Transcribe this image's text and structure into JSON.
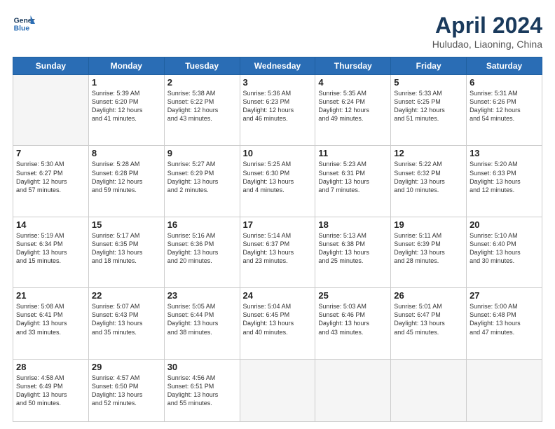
{
  "header": {
    "logo_line1": "General",
    "logo_line2": "Blue",
    "month": "April 2024",
    "location": "Huludao, Liaoning, China"
  },
  "days_of_week": [
    "Sunday",
    "Monday",
    "Tuesday",
    "Wednesday",
    "Thursday",
    "Friday",
    "Saturday"
  ],
  "weeks": [
    [
      {
        "day": null
      },
      {
        "day": "1",
        "sunrise": "5:39 AM",
        "sunset": "6:20 PM",
        "daylight": "12 hours and 41 minutes."
      },
      {
        "day": "2",
        "sunrise": "5:38 AM",
        "sunset": "6:22 PM",
        "daylight": "12 hours and 43 minutes."
      },
      {
        "day": "3",
        "sunrise": "5:36 AM",
        "sunset": "6:23 PM",
        "daylight": "12 hours and 46 minutes."
      },
      {
        "day": "4",
        "sunrise": "5:35 AM",
        "sunset": "6:24 PM",
        "daylight": "12 hours and 49 minutes."
      },
      {
        "day": "5",
        "sunrise": "5:33 AM",
        "sunset": "6:25 PM",
        "daylight": "12 hours and 51 minutes."
      },
      {
        "day": "6",
        "sunrise": "5:31 AM",
        "sunset": "6:26 PM",
        "daylight": "12 hours and 54 minutes."
      }
    ],
    [
      {
        "day": "7",
        "sunrise": "5:30 AM",
        "sunset": "6:27 PM",
        "daylight": "12 hours and 57 minutes."
      },
      {
        "day": "8",
        "sunrise": "5:28 AM",
        "sunset": "6:28 PM",
        "daylight": "12 hours and 59 minutes."
      },
      {
        "day": "9",
        "sunrise": "5:27 AM",
        "sunset": "6:29 PM",
        "daylight": "13 hours and 2 minutes."
      },
      {
        "day": "10",
        "sunrise": "5:25 AM",
        "sunset": "6:30 PM",
        "daylight": "13 hours and 4 minutes."
      },
      {
        "day": "11",
        "sunrise": "5:23 AM",
        "sunset": "6:31 PM",
        "daylight": "13 hours and 7 minutes."
      },
      {
        "day": "12",
        "sunrise": "5:22 AM",
        "sunset": "6:32 PM",
        "daylight": "13 hours and 10 minutes."
      },
      {
        "day": "13",
        "sunrise": "5:20 AM",
        "sunset": "6:33 PM",
        "daylight": "13 hours and 12 minutes."
      }
    ],
    [
      {
        "day": "14",
        "sunrise": "5:19 AM",
        "sunset": "6:34 PM",
        "daylight": "13 hours and 15 minutes."
      },
      {
        "day": "15",
        "sunrise": "5:17 AM",
        "sunset": "6:35 PM",
        "daylight": "13 hours and 18 minutes."
      },
      {
        "day": "16",
        "sunrise": "5:16 AM",
        "sunset": "6:36 PM",
        "daylight": "13 hours and 20 minutes."
      },
      {
        "day": "17",
        "sunrise": "5:14 AM",
        "sunset": "6:37 PM",
        "daylight": "13 hours and 23 minutes."
      },
      {
        "day": "18",
        "sunrise": "5:13 AM",
        "sunset": "6:38 PM",
        "daylight": "13 hours and 25 minutes."
      },
      {
        "day": "19",
        "sunrise": "5:11 AM",
        "sunset": "6:39 PM",
        "daylight": "13 hours and 28 minutes."
      },
      {
        "day": "20",
        "sunrise": "5:10 AM",
        "sunset": "6:40 PM",
        "daylight": "13 hours and 30 minutes."
      }
    ],
    [
      {
        "day": "21",
        "sunrise": "5:08 AM",
        "sunset": "6:41 PM",
        "daylight": "13 hours and 33 minutes."
      },
      {
        "day": "22",
        "sunrise": "5:07 AM",
        "sunset": "6:43 PM",
        "daylight": "13 hours and 35 minutes."
      },
      {
        "day": "23",
        "sunrise": "5:05 AM",
        "sunset": "6:44 PM",
        "daylight": "13 hours and 38 minutes."
      },
      {
        "day": "24",
        "sunrise": "5:04 AM",
        "sunset": "6:45 PM",
        "daylight": "13 hours and 40 minutes."
      },
      {
        "day": "25",
        "sunrise": "5:03 AM",
        "sunset": "6:46 PM",
        "daylight": "13 hours and 43 minutes."
      },
      {
        "day": "26",
        "sunrise": "5:01 AM",
        "sunset": "6:47 PM",
        "daylight": "13 hours and 45 minutes."
      },
      {
        "day": "27",
        "sunrise": "5:00 AM",
        "sunset": "6:48 PM",
        "daylight": "13 hours and 47 minutes."
      }
    ],
    [
      {
        "day": "28",
        "sunrise": "4:58 AM",
        "sunset": "6:49 PM",
        "daylight": "13 hours and 50 minutes."
      },
      {
        "day": "29",
        "sunrise": "4:57 AM",
        "sunset": "6:50 PM",
        "daylight": "13 hours and 52 minutes."
      },
      {
        "day": "30",
        "sunrise": "4:56 AM",
        "sunset": "6:51 PM",
        "daylight": "13 hours and 55 minutes."
      },
      {
        "day": null
      },
      {
        "day": null
      },
      {
        "day": null
      },
      {
        "day": null
      }
    ]
  ]
}
